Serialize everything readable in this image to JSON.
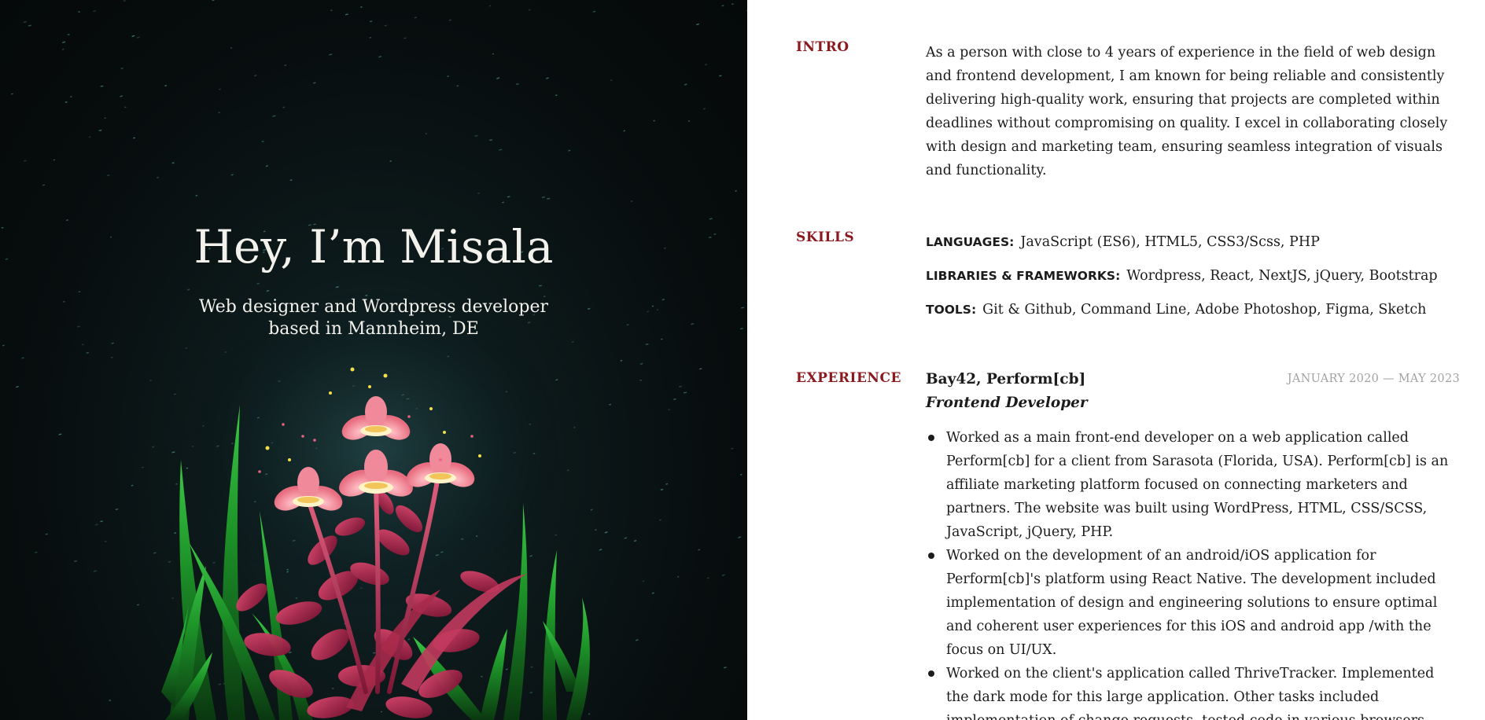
{
  "hero": {
    "title": "Hey, I’m Misala",
    "subtitle": "Web designer and Wordpress developer based in Mannheim, DE"
  },
  "sections": {
    "intro": {
      "label": "INTRO",
      "text": "As a person with close to 4 years of experience in the field of web design and frontend development, I am known for being reliable and consistently delivering high-quality work, ensuring that projects are completed within deadlines without compromising on quality. I excel in collaborating closely with design and marketing team, ensuring seamless integration of visuals and functionality."
    },
    "skills": {
      "label": "SKILLS",
      "rows": [
        {
          "key": "LANGUAGES:",
          "value": "JavaScript (ES6), HTML5, CSS3/Scss, PHP"
        },
        {
          "key": "LIBRARIES & FRAMEWORKS:",
          "value": "Wordpress, React, NextJS, jQuery, Bootstrap"
        },
        {
          "key": "TOOLS:",
          "value": "Git & Github, Command Line, Adobe Photoshop, Figma, Sketch"
        }
      ]
    },
    "experience": {
      "label": "EXPERIENCE",
      "jobs": [
        {
          "company": "Bay42, Perform[cb]",
          "dates": "JANUARY 2020 — MAY 2023",
          "role": "Frontend Developer",
          "bullets": [
            "Worked as a main front-end developer on a web application called Perform[cb] for a client from Sarasota (Florida, USA). Perform[cb] is an affiliate marketing platform focused on connecting marketers and partners. The website was built using WordPress, HTML, CSS/SCSS, JavaScript, jQuery, PHP.",
            "Worked on the development of an android/iOS application for Perform[cb]'s platform using React Native. The development included implementation of design and engineering solutions to ensure optimal and coherent user experiences for this iOS and android app /with the focus on UI/UX.",
            "Worked on the client's application called ThriveTracker. Implemented the dark mode for this large application. Other tasks included implementation of change requests, tested code in various browsers"
          ]
        }
      ]
    }
  },
  "colors": {
    "accent": "#8b1a1f",
    "hero_bg": "#070c0d",
    "dates": "#a2a2a2"
  }
}
